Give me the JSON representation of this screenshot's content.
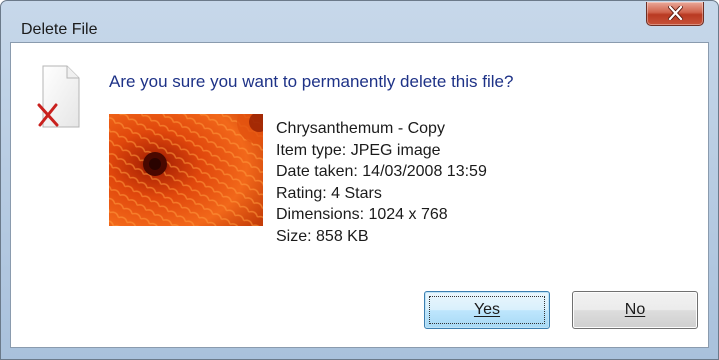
{
  "window": {
    "title": "Delete File",
    "close_icon": "close-icon"
  },
  "dialog": {
    "question": "Are you sure you want to permanently delete this file?",
    "file_icon": "file-delete-icon",
    "file": {
      "name": "Chrysanthemum - Copy",
      "item_type": "Item type: JPEG image",
      "date_taken": "Date taken: 14/03/2008 13:59",
      "rating": "Rating: 4 Stars",
      "dimensions": "Dimensions: 1024 x 768",
      "size": "Size: 858 KB"
    },
    "buttons": {
      "yes": "Yes",
      "no": "No"
    }
  },
  "colors": {
    "question_text": "#1e3287",
    "titlebar": "#b9cde3",
    "close_button": "#c8533a",
    "default_button": "#bee6fd"
  }
}
